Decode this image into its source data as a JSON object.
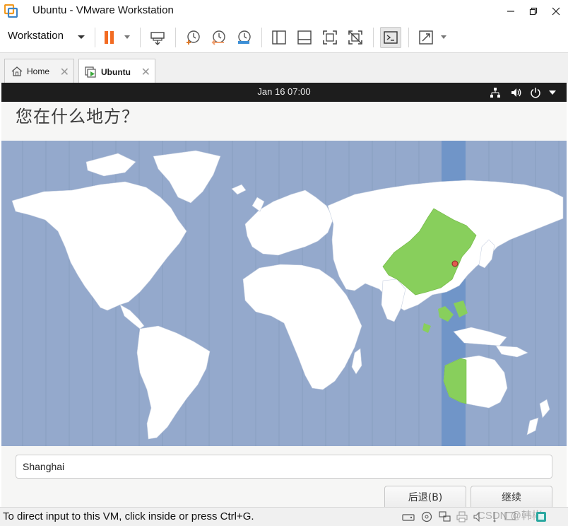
{
  "window": {
    "title": "Ubuntu - VMware Workstation",
    "logo_icon": "vmware-logo-icon",
    "controls": [
      "minimize-icon",
      "restore-icon",
      "close-icon"
    ]
  },
  "toolbar": {
    "menu_label": "Workstation",
    "buttons": [
      "pause-icon",
      "send-ctrl-alt-del-icon",
      "snapshot-take-icon",
      "snapshot-revert-icon",
      "snapshot-manager-icon",
      "library-view-icon",
      "thumbnail-view-icon",
      "fullscreen-icon",
      "unity-icon",
      "console-view-icon",
      "stretch-view-icon"
    ]
  },
  "tabs": [
    {
      "label": "Home",
      "icon": "home-icon"
    },
    {
      "label": "Ubuntu",
      "icon": "vm-running-icon",
      "active": true
    }
  ],
  "guest": {
    "clock": "Jan 16  07:00",
    "tray": [
      "network-icon",
      "volume-icon",
      "power-icon",
      "menu-arrow-icon"
    ],
    "heading": "您在什么地方？",
    "timezone_value": "Shanghai",
    "back_button": "后退(B)",
    "continue_button": "继续",
    "colors": {
      "ocean": "#94a9cc",
      "land": "#ffffff",
      "selected_zone": "#7095c8",
      "selected_country": "#88cf5c",
      "marker": "#e05a4f"
    }
  },
  "statusbar": {
    "message": "To direct input to this VM, click inside or press Ctrl+G.",
    "icons": [
      "hard-disk-icon",
      "cd-dvd-icon",
      "network-adapter-icon",
      "printer-icon",
      "sound-icon",
      "usb-icon",
      "display-icon",
      "vmware-tools-icon"
    ],
    "watermark": "CSDN @韩彬"
  }
}
